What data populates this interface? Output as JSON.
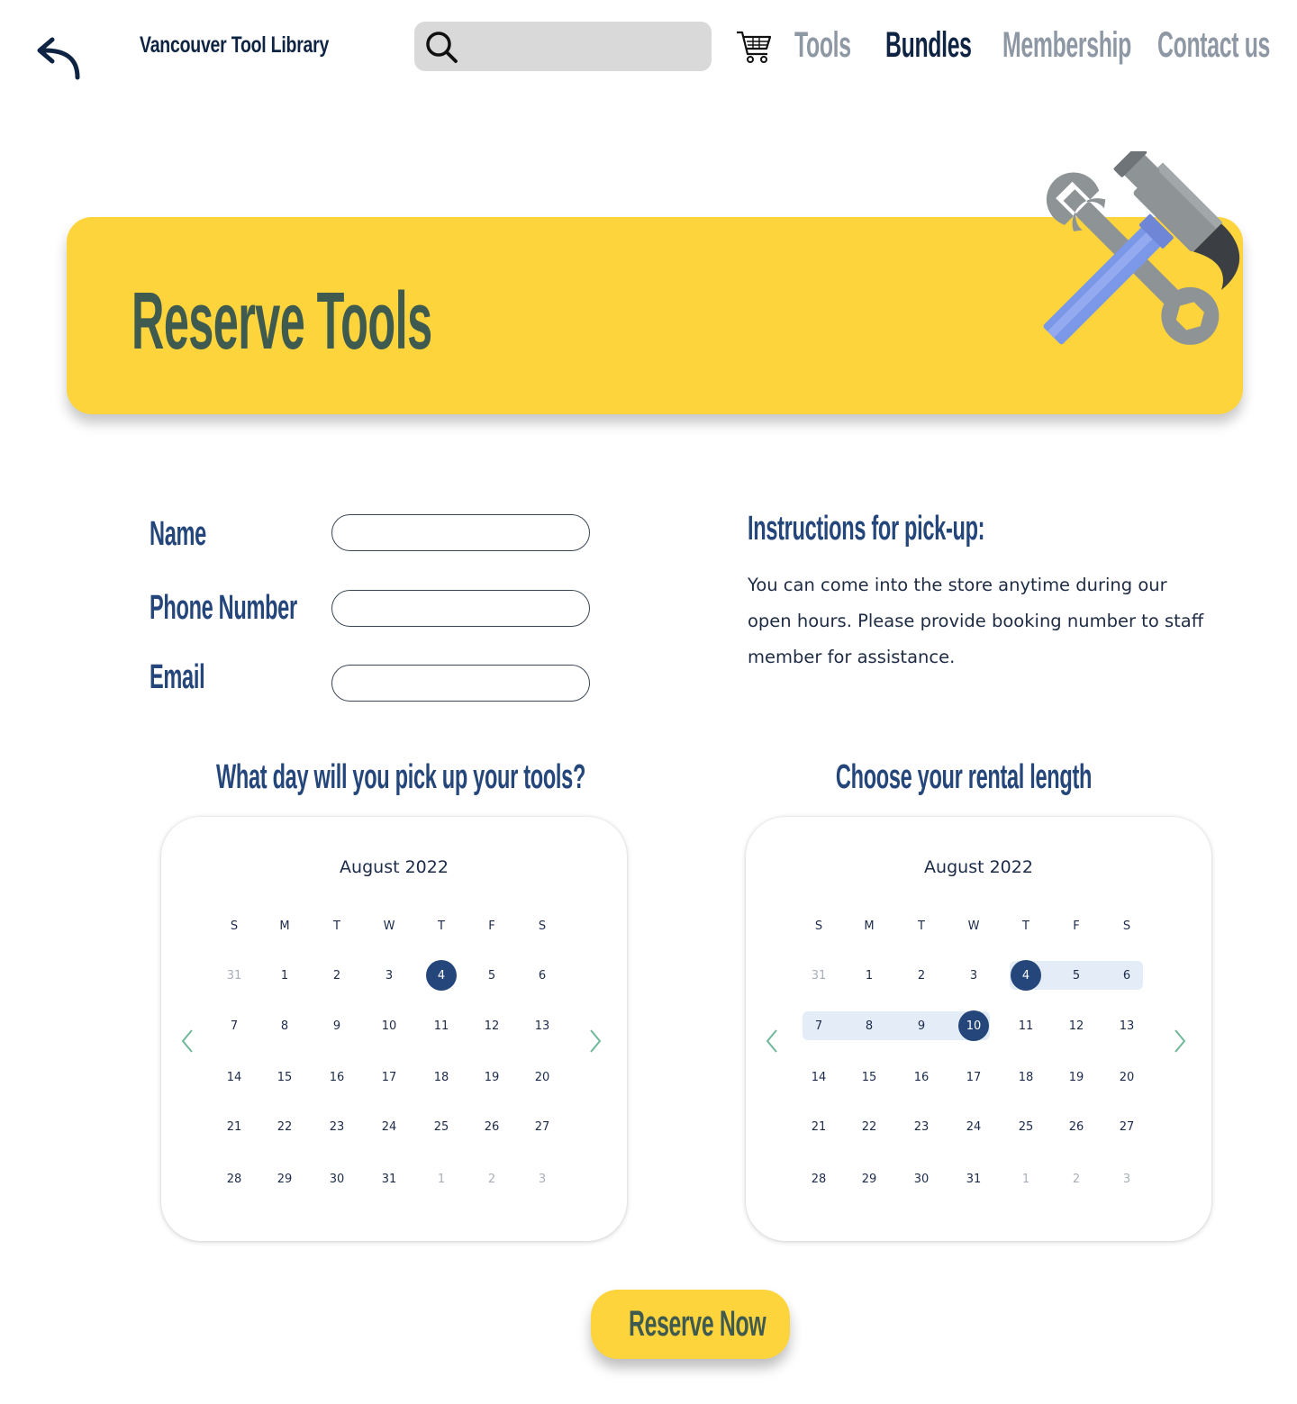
{
  "header": {
    "brand": "Vancouver Tool Library",
    "search_placeholder": "",
    "nav": {
      "tools": "Tools",
      "bundles": "Bundles",
      "membership": "Membership",
      "contact": "Contact us"
    },
    "active_nav": "Bundles"
  },
  "banner": {
    "title": "Reserve Tools"
  },
  "form": {
    "name_label": "Name",
    "phone_label": "Phone Number",
    "email_label": "Email",
    "name_value": "",
    "phone_value": "",
    "email_value": ""
  },
  "instructions": {
    "title": "Instructions for pick-up:",
    "text": "You can come into the store anytime during our open hours. Please provide booking number to staff member for assistance."
  },
  "pickup_calendar": {
    "heading": "What day will you pick up your tools?",
    "month": "August 2022",
    "weekdays": [
      "S",
      "M",
      "T",
      "W",
      "T",
      "F",
      "S"
    ],
    "selected": [
      4
    ],
    "range": []
  },
  "rental_calendar": {
    "heading": "Choose your rental length",
    "month": "August 2022",
    "weekdays": [
      "S",
      "M",
      "T",
      "W",
      "T",
      "F",
      "S"
    ],
    "selected": [
      4,
      10
    ],
    "range": [
      4,
      10
    ]
  },
  "weeks": [
    [
      [
        "31",
        "muted"
      ],
      [
        "1",
        ""
      ],
      [
        "2",
        ""
      ],
      [
        "3",
        ""
      ],
      [
        "4",
        ""
      ],
      [
        "5",
        ""
      ],
      [
        "6",
        ""
      ]
    ],
    [
      [
        "7",
        ""
      ],
      [
        "8",
        ""
      ],
      [
        "9",
        ""
      ],
      [
        "10",
        ""
      ],
      [
        "11",
        ""
      ],
      [
        "12",
        ""
      ],
      [
        "13",
        ""
      ]
    ],
    [
      [
        "14",
        ""
      ],
      [
        "15",
        ""
      ],
      [
        "16",
        ""
      ],
      [
        "17",
        ""
      ],
      [
        "18",
        ""
      ],
      [
        "19",
        ""
      ],
      [
        "20",
        ""
      ]
    ],
    [
      [
        "21",
        ""
      ],
      [
        "22",
        ""
      ],
      [
        "23",
        ""
      ],
      [
        "24",
        ""
      ],
      [
        "25",
        ""
      ],
      [
        "26",
        ""
      ],
      [
        "27",
        ""
      ]
    ],
    [
      [
        "28",
        ""
      ],
      [
        "29",
        ""
      ],
      [
        "30",
        ""
      ],
      [
        "31",
        ""
      ],
      [
        "1",
        "muted"
      ],
      [
        "2",
        "muted"
      ],
      [
        "3",
        "muted"
      ]
    ]
  ],
  "actions": {
    "reserve": "Reserve Now"
  },
  "colors": {
    "accent_yellow": "#fed43c",
    "navy": "#24467a",
    "dark_green": "#3f5a4f",
    "range_fill": "#e4ecf7",
    "muted_nav": "#8e98a4"
  }
}
